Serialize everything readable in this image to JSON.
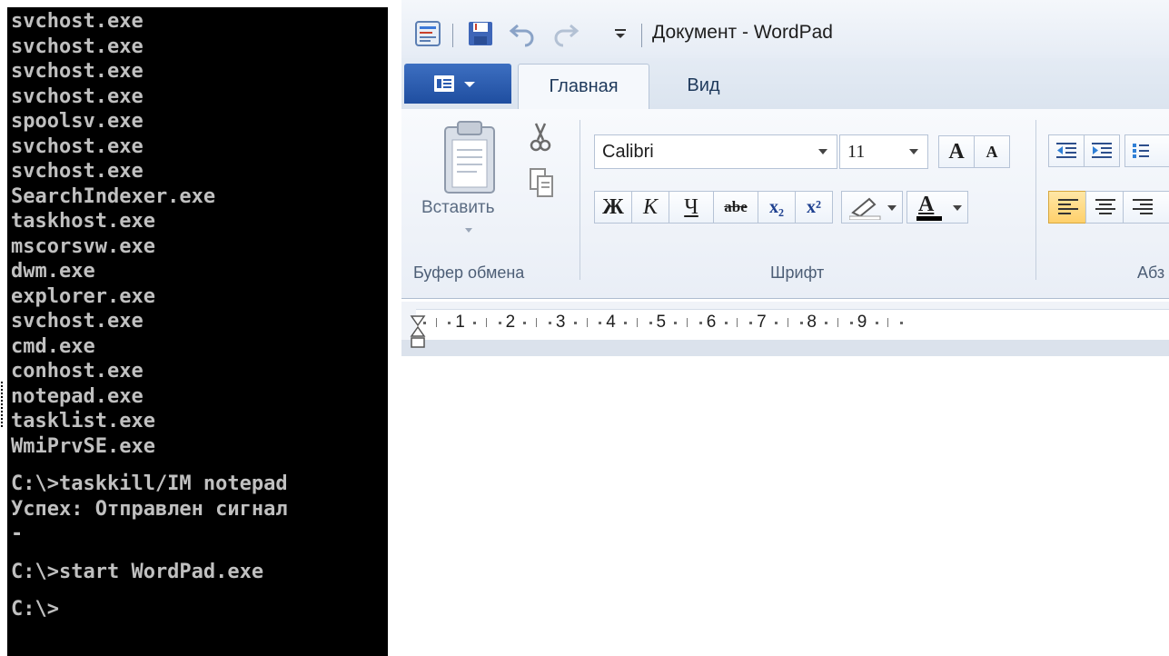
{
  "console": {
    "lines": [
      "svchost.exe",
      "svchost.exe",
      "svchost.exe",
      "svchost.exe",
      "spoolsv.exe",
      "svchost.exe",
      "svchost.exe",
      "SearchIndexer.exe",
      "taskhost.exe",
      "mscorsvw.exe",
      "dwm.exe",
      "explorer.exe",
      "svchost.exe",
      "cmd.exe",
      "conhost.exe",
      "notepad.exe",
      "tasklist.exe",
      "WmiPrvSE.exe",
      "",
      "C:\\>taskkill/IM notepad",
      "Успех: Отправлен сигнал",
      "-",
      "",
      "C:\\>start WordPad.exe",
      "",
      "C:\\>"
    ]
  },
  "wordpad": {
    "title": "Документ - WordPad",
    "tabs": {
      "home": "Главная",
      "view": "Вид"
    },
    "clipboard": {
      "paste_label": "Вставить",
      "group_label": "Буфер обмена"
    },
    "font": {
      "family": "Calibri",
      "size": "11",
      "grow": "A",
      "shrink": "A",
      "bold": "Ж",
      "italic": "К",
      "underline": "Ч",
      "strike": "abe",
      "subscript": "x₂",
      "superscript": "x²",
      "color_letter": "A",
      "group_label": "Шрифт"
    },
    "paragraph": {
      "group_label": "Абз"
    },
    "ruler": {
      "numbers": [
        "1",
        "2",
        "3",
        "4",
        "5",
        "6",
        "7",
        "8",
        "9"
      ]
    }
  }
}
